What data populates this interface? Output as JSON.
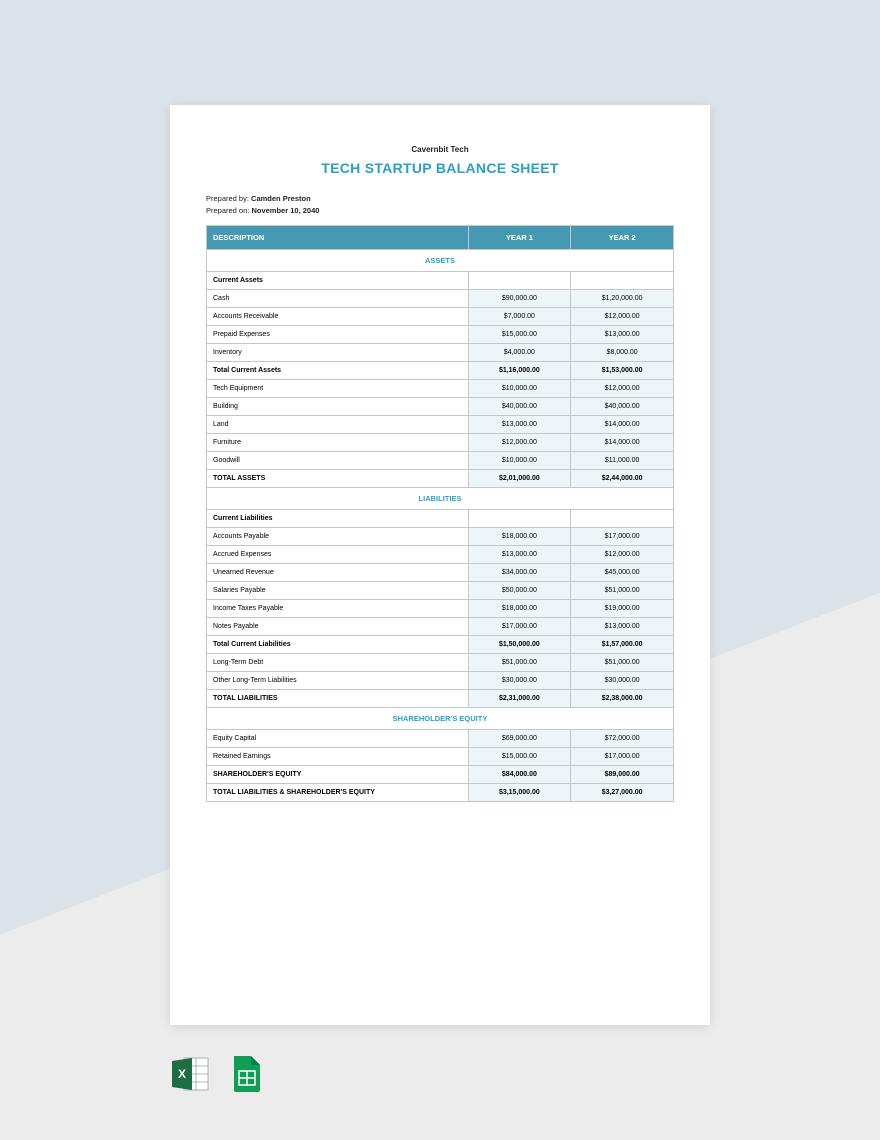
{
  "company": "Cavernbit Tech",
  "title": "TECH STARTUP BALANCE SHEET",
  "prepared_by_label": "Prepared by:",
  "prepared_by": "Camden Preston",
  "prepared_on_label": "Prepared on:",
  "prepared_on": "November 10, 2040",
  "columns": {
    "desc": "DESCRIPTION",
    "y1": "YEAR 1",
    "y2": "YEAR 2"
  },
  "sections": {
    "assets": "ASSETS",
    "liabilities": "LIABILITIES",
    "equity": "SHAREHOLDER'S EQUITY"
  },
  "rows": {
    "assets_hdr": {
      "label": "Current Assets",
      "y1": "",
      "y2": ""
    },
    "cash": {
      "label": "Cash",
      "y1": "$90,000.00",
      "y2": "$1,20,000.00"
    },
    "ar": {
      "label": "Accounts Receivable",
      "y1": "$7,000.00",
      "y2": "$12,000.00"
    },
    "prepaid": {
      "label": "Prepaid Expenses",
      "y1": "$15,000.00",
      "y2": "$13,000.00"
    },
    "inventory": {
      "label": "Inventory",
      "y1": "$4,000.00",
      "y2": "$8,000.00"
    },
    "tca": {
      "label": "Total Current Assets",
      "y1": "$1,16,000.00",
      "y2": "$1,53,000.00"
    },
    "tech": {
      "label": "Tech Equipment",
      "y1": "$10,000.00",
      "y2": "$12,000.00"
    },
    "building": {
      "label": "Building",
      "y1": "$40,000.00",
      "y2": "$40,000.00"
    },
    "land": {
      "label": "Land",
      "y1": "$13,000.00",
      "y2": "$14,000.00"
    },
    "furniture": {
      "label": "Furniture",
      "y1": "$12,000.00",
      "y2": "$14,000.00"
    },
    "goodwill": {
      "label": "Goodwill",
      "y1": "$10,000.00",
      "y2": "$11,000.00"
    },
    "ta": {
      "label": "TOTAL ASSETS",
      "y1": "$2,01,000.00",
      "y2": "$2,44,000.00"
    },
    "liab_hdr": {
      "label": "Current Liabilities",
      "y1": "",
      "y2": ""
    },
    "ap": {
      "label": "Accounts Payable",
      "y1": "$18,000.00",
      "y2": "$17,000.00"
    },
    "accrued": {
      "label": "Accrued Expenses",
      "y1": "$13,000.00",
      "y2": "$12,000.00"
    },
    "unearned": {
      "label": "Unearned Revenue",
      "y1": "$34,000.00",
      "y2": "$45,000.00"
    },
    "salaries": {
      "label": "Salaries Payable",
      "y1": "$50,000.00",
      "y2": "$51,000.00"
    },
    "taxes": {
      "label": "Income Taxes Payable",
      "y1": "$18,000.00",
      "y2": "$19,000.00"
    },
    "notes": {
      "label": "Notes Payable",
      "y1": "$17,000.00",
      "y2": "$13,000.00"
    },
    "tcl": {
      "label": "Total Current Liabilities",
      "y1": "$1,50,000.00",
      "y2": "$1,57,000.00"
    },
    "ltd": {
      "label": "Long-Term Debt",
      "y1": "$51,000.00",
      "y2": "$51,000.00"
    },
    "other_lt": {
      "label": "Other Long-Term Liabilities",
      "y1": "$30,000.00",
      "y2": "$30,000.00"
    },
    "tl": {
      "label": "TOTAL LIABILITIES",
      "y1": "$2,31,000.00",
      "y2": "$2,38,000.00"
    },
    "eq_cap": {
      "label": "Equity Capital",
      "y1": "$69,000.00",
      "y2": "$72,000.00"
    },
    "retained": {
      "label": "Retained Earnings",
      "y1": "$15,000.00",
      "y2": "$17,000.00"
    },
    "se": {
      "label": "SHAREHOLDER'S EQUITY",
      "y1": "$84,000.00",
      "y2": "$89,000.00"
    },
    "tlse": {
      "label": "TOTAL LIABILITIES & SHAREHOLDER'S EQUITY",
      "y1": "$3,15,000.00",
      "y2": "$3,27,000.00"
    }
  },
  "icons": {
    "excel": "excel-icon",
    "sheets": "google-sheets-icon"
  }
}
